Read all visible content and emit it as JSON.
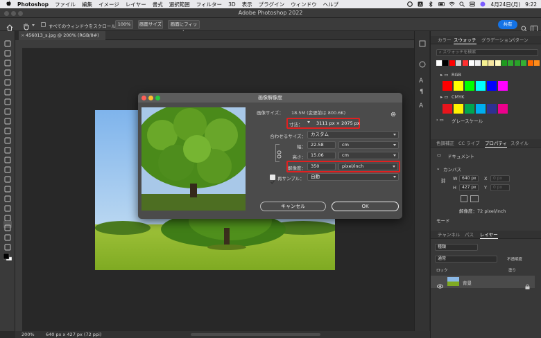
{
  "menubar": {
    "app": "Photoshop",
    "items": [
      "ファイル",
      "編集",
      "イメージ",
      "レイヤー",
      "書式",
      "選択範囲",
      "フィルター",
      "3D",
      "表示",
      "プラグイン",
      "ウィンドウ",
      "ヘルプ"
    ],
    "date": "4月24日(月)",
    "time": "9:22"
  },
  "window": {
    "title": "Adobe Photoshop 2022"
  },
  "options": {
    "scroll_all": "すべてのウィンドウをスクロール",
    "zoom": "100%",
    "fit_screen": "画面サイズ",
    "fill_screen": "画面にフィット",
    "share": "共有"
  },
  "document": {
    "tab": "456013_s.jpg @ 200% (RGB/8#)"
  },
  "status": {
    "zoom": "200%",
    "info": "640 px x 427 px (72 ppi)"
  },
  "dialog": {
    "title": "画像解像度",
    "image_size_label": "画像サイズ：",
    "image_size_value": "18.5M (変更前は 800.6K)",
    "dimensions_label": "寸法：",
    "dimensions_value": "3111 px × 2075 px",
    "fit_label": "合わせるサイズ：",
    "fit_value": "カスタム",
    "width_label": "幅：",
    "width_value": "22.58",
    "width_unit": "cm",
    "height_label": "高さ：",
    "height_value": "15.06",
    "height_unit": "cm",
    "res_label": "解像度：",
    "res_value": "350",
    "res_unit": "pixel/inch",
    "resample_label": "再サンプル：",
    "resample_value": "自動",
    "cancel": "キャンセル",
    "ok": "OK"
  },
  "swatches": {
    "tabs": [
      "カラー",
      "スウォッチ",
      "グラデーション",
      "パターン"
    ],
    "search_placeholder": "スウォッチを検索",
    "recent": [
      "#ffffff",
      "#000000",
      "#ff0000",
      "#cfcfcf",
      "#ff3030",
      "#ffffff",
      "#f0f0f0",
      "#f5f090",
      "#f6e6a0",
      "#fff9c0",
      "#1e9b1e",
      "#2ea82e",
      "#29a329",
      "#34b034",
      "#ff6a00",
      "#ff8c1a"
    ],
    "groups": [
      {
        "name": "RGB",
        "colors": [
          "#ff0000",
          "#ffff00",
          "#00ff00",
          "#00ffff",
          "#0000ff",
          "#ff00ff"
        ]
      },
      {
        "name": "CMYK",
        "colors": [
          "#e8141c",
          "#fff200",
          "#00a651",
          "#00aeef",
          "#2e3192",
          "#ec008c"
        ]
      },
      {
        "name": "グレースケール",
        "colors": []
      }
    ]
  },
  "properties": {
    "tabs": [
      "色調補正",
      "CC ライブ",
      "プロパティ",
      "スタイル"
    ],
    "doc_label": "ドキュメント",
    "canvas_label": "カンバス",
    "w_label": "W",
    "w_value": "640 px",
    "h_label": "H",
    "h_value": "427 px",
    "x_label": "X",
    "y_label": "Y",
    "x_placeholder": "0 px",
    "y_placeholder": "0 px",
    "res_text": "解像度：72 pixel/inch",
    "mode_label": "モード"
  },
  "layers": {
    "tabs": [
      "チャンネル",
      "パス",
      "レイヤー"
    ],
    "kind": "種類",
    "blend": "通常",
    "opacity_label": "不透明度",
    "lock_label": "ロック",
    "fill_label": "塗り",
    "layer_name": "背景"
  },
  "colors": {
    "accent": "#1473e6",
    "highlight": "#e02020"
  }
}
